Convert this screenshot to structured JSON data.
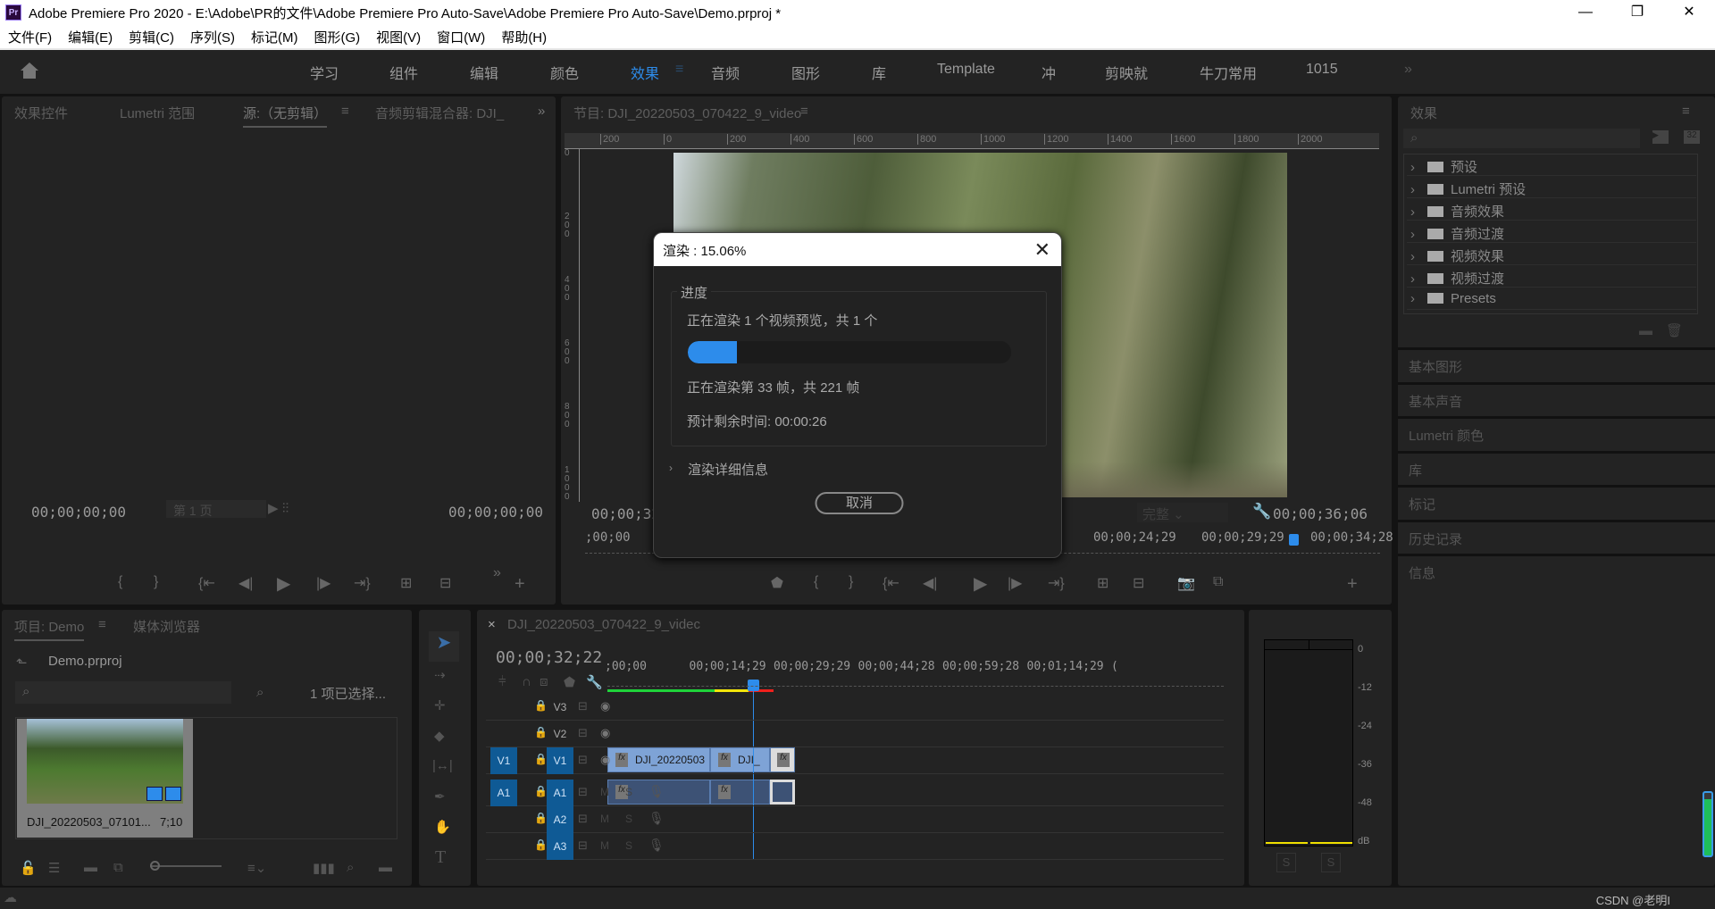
{
  "window": {
    "title": "Adobe Premiere Pro 2020 - E:\\Adobe\\PR的文件\\Adobe Premiere Pro Auto-Save\\Adobe Premiere Pro Auto-Save\\Demo.prproj *",
    "icon_text": "Pr",
    "minimize": "—",
    "restore": "❐",
    "close": "✕"
  },
  "menu": [
    "文件(F)",
    "编辑(E)",
    "剪辑(C)",
    "序列(S)",
    "标记(M)",
    "图形(G)",
    "视图(V)",
    "窗口(W)",
    "帮助(H)"
  ],
  "workspaces": {
    "tabs": [
      "学习",
      "组件",
      "编辑",
      "颜色",
      "效果",
      "音频",
      "图形",
      "库",
      "Template",
      "冲",
      "剪映就",
      "牛刀常用",
      "1015"
    ],
    "active": "效果",
    "menu_icon": "≡",
    "overflow": "»"
  },
  "source_panel": {
    "tabs": [
      "效果控件",
      "Lumetri 范围",
      "源:（无剪辑）",
      "音频剪辑混合器: DJI_"
    ],
    "active_tab": "源:（无剪辑）",
    "overflow": "»",
    "timecode_in": "00;00;00;00",
    "timecode_out": "00;00;00;00",
    "page_select": "第 1 页"
  },
  "program_panel": {
    "title": "节目: DJI_20220503_070422_9_video",
    "ruler_h": [
      "200",
      "0",
      "200",
      "400",
      "600",
      "800",
      "1000",
      "1200",
      "1400",
      "1600",
      "1800",
      "2000"
    ],
    "ruler_v": [
      "0",
      "200",
      "400",
      "600",
      "800",
      "1000"
    ],
    "timecode_current": "00;00;32",
    "fit": "完整",
    "timecode_duration": "00;00;36;06",
    "mini_ruler": [
      ";00;00",
      "00;00;24;29",
      "00;00;29;29",
      "00;00;34;28"
    ]
  },
  "render_dialog": {
    "title": "渲染 : 15.06%",
    "group_label": "进度",
    "line1": "正在渲染 1 个视频预览，共 1 个",
    "progress": 0.1506,
    "line2": "正在渲染第 33 帧，共 221 帧",
    "line3": "预计剩余时间: 00:00:26",
    "details": "渲染详细信息",
    "cancel": "取消",
    "accent": "#2d8ceb"
  },
  "effects_panel": {
    "title": "效果",
    "items": [
      "预设",
      "Lumetri 预设",
      "音频效果",
      "音频过渡",
      "视频效果",
      "视频过渡",
      "Presets"
    ],
    "starred": [
      true,
      true,
      false,
      false,
      false,
      false,
      true
    ],
    "collapsed_panels": [
      "基本图形",
      "基本声音",
      "Lumetri 颜色",
      "库",
      "标记",
      "历史记录",
      "信息"
    ]
  },
  "project_panel": {
    "tabs": [
      "项目: Demo",
      "媒体浏览器"
    ],
    "file": "Demo.prproj",
    "selection": "1 项已选择...",
    "clip_name": "DJI_20220503_07101...",
    "clip_duration": "7;10"
  },
  "timeline": {
    "sequence": "DJI_20220503_070422_9_videc",
    "close": "×",
    "timecode": "00;00;32;22",
    "ruler": [
      ";00;00",
      "00;00;14;29",
      "00;00;29;29",
      "00;00;44;28",
      "00;00;59;28",
      "00;01;14;29",
      "("
    ],
    "tracks": [
      {
        "src": "",
        "name": "V3",
        "type": "video"
      },
      {
        "src": "",
        "name": "V2",
        "type": "video"
      },
      {
        "src": "V1",
        "name": "V1",
        "type": "video"
      },
      {
        "src": "A1",
        "name": "A1",
        "type": "audio"
      },
      {
        "src": "",
        "name": "A2",
        "type": "audio"
      },
      {
        "src": "",
        "name": "A3",
        "type": "audio"
      }
    ],
    "mute": "M",
    "solo": "S",
    "clips": [
      "DJI_20220503",
      "DJI_"
    ],
    "fx": "fx",
    "render_bar_colors": [
      "#1fd33a",
      "#f3e50a",
      "#f0201c"
    ]
  },
  "audio_meter": {
    "scale": [
      "0",
      "-12",
      "-24",
      "-36",
      "-48",
      "dB"
    ],
    "solo": [
      "S",
      "S"
    ]
  },
  "status": {
    "watermark": "CSDN @老明I"
  }
}
